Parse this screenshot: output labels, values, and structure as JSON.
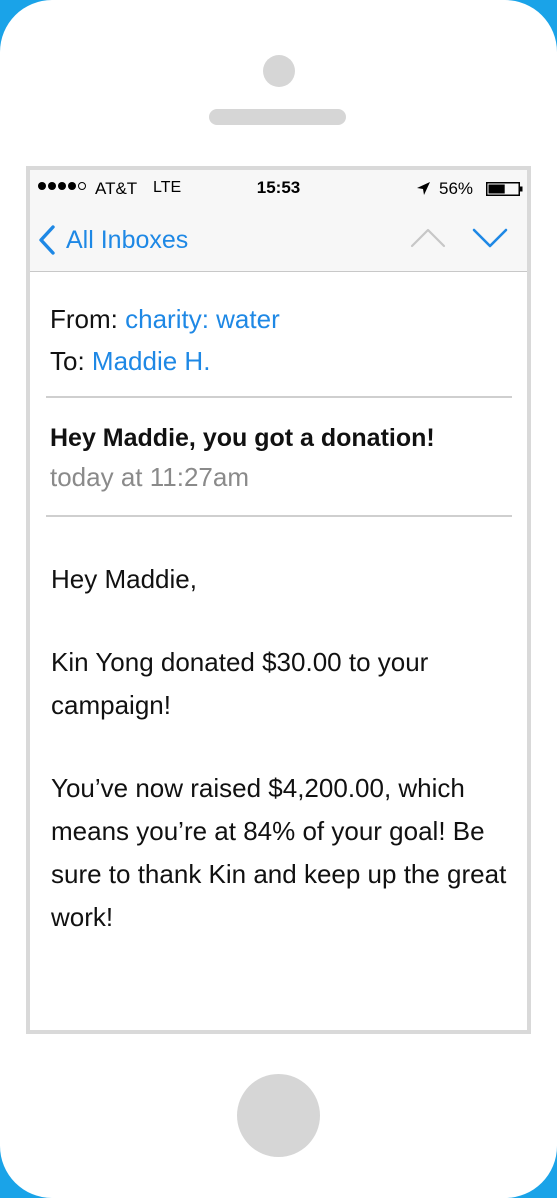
{
  "status_bar": {
    "carrier": "AT&T",
    "network": "LTE",
    "time": "15:53",
    "battery_percent": "56%",
    "battery_level": 0.56,
    "signal_bars_filled": 4,
    "signal_bars_total": 5
  },
  "nav": {
    "back_label": "All Inboxes",
    "up_icon": "chevron-up-icon",
    "down_icon": "chevron-down-icon"
  },
  "email": {
    "from_label": "From:",
    "from_name": "charity: water",
    "to_label": "To:",
    "to_name": "Maddie H.",
    "subject": "Hey Maddie, you got a donation!",
    "date": "today at 11:27am",
    "body": {
      "greeting": "Hey Maddie,",
      "paragraph_1": "Kin Yong donated $30.00 to your campaign!",
      "paragraph_2": "You’ve now raised $4,200.00, which means you’re at 84% of your goal! Be sure to thank Kin and keep up the great work!"
    }
  },
  "colors": {
    "accent": "#1e88e5",
    "frame": "#1aa3e8",
    "muted": "#8a8a8a"
  }
}
